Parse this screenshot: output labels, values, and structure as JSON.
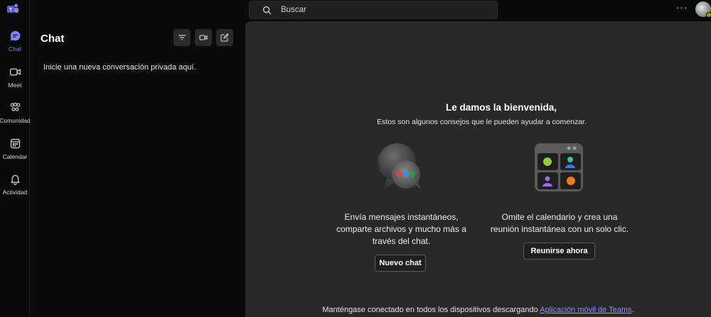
{
  "rail": {
    "items": [
      {
        "label": "Chat",
        "icon": "chat-icon"
      },
      {
        "label": "Meet",
        "icon": "video-icon"
      },
      {
        "label": "Comunidad",
        "icon": "community-icon"
      },
      {
        "label": "Calendar",
        "icon": "calendar-icon"
      },
      {
        "label": "Actividad",
        "icon": "bell-icon"
      }
    ]
  },
  "search": {
    "placeholder": "Buscar"
  },
  "topbar": {
    "more_label": "···"
  },
  "chat_panel": {
    "title": "Chat",
    "empty_text": "Inicie una nueva conversación privada aquí."
  },
  "main": {
    "welcome_title": "Le damos la bienvenida,",
    "welcome_sub": "Estos son algunos consejos que le pueden ayudar a comenzar.",
    "card_chat": {
      "line1": "Envía mensajes instantáneos,",
      "line2": "comparte archivos y mucho más a",
      "line3": "través del chat.",
      "button": "Nuevo chat"
    },
    "card_meet": {
      "line1": "Omite el calendario y crea una",
      "line2": "reunión instantánea con un solo clic.",
      "button": "Reunirse ahora"
    },
    "footer_text": "Manténgase conectado en todos los dispositivos descargando ",
    "footer_link": "Aplicación móvil de Teams",
    "footer_end": "."
  },
  "colors": {
    "accent": "#7f85f5",
    "background": "#0a0a0a",
    "main_panel": "#292929",
    "link": "#8b8fff",
    "presence": "#6bb700"
  }
}
